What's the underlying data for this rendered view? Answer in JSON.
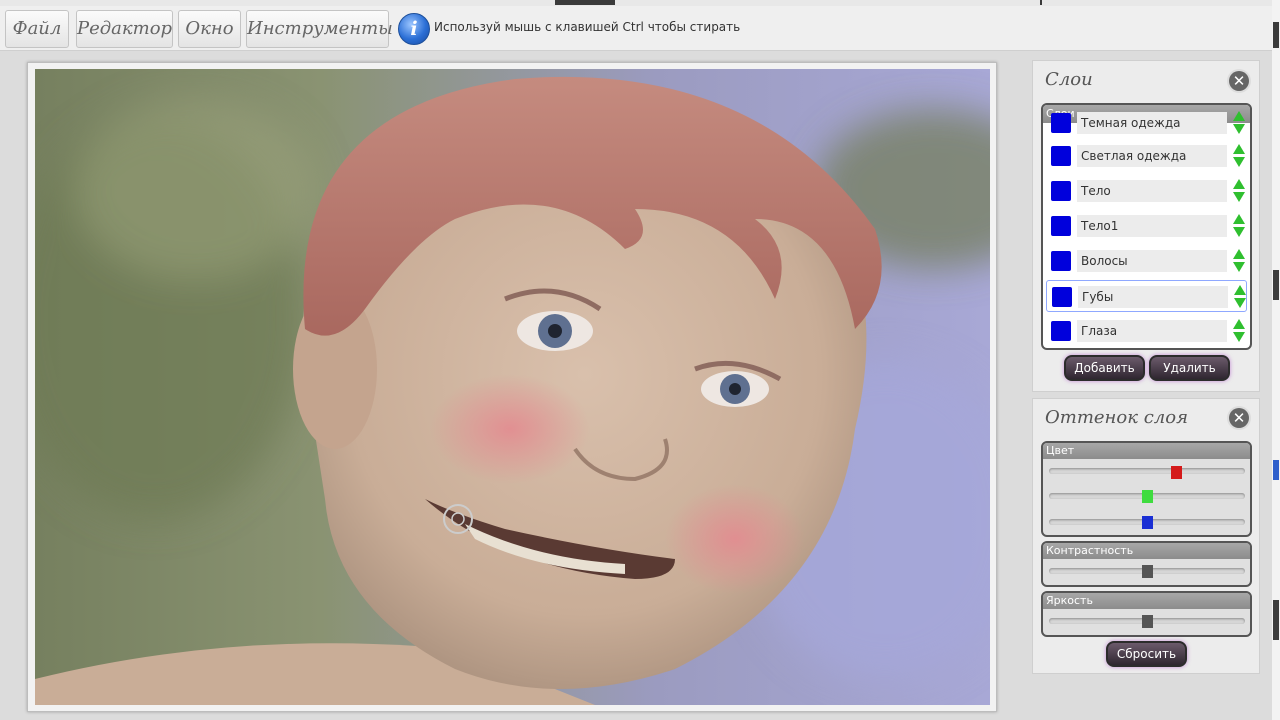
{
  "menu": {
    "file": "Файл",
    "editor": "Редактор",
    "window": "Окно",
    "tools": "Инструменты"
  },
  "hint": {
    "icon": "info-icon",
    "text": "Используй мышь с клавишей Ctrl чтобы стирать"
  },
  "layers_panel": {
    "title": "Слои",
    "box_header": "Слои",
    "items": [
      {
        "label": "Темная одежда"
      },
      {
        "label": "Светлая одежда"
      },
      {
        "label": "Тело"
      },
      {
        "label": "Тело1"
      },
      {
        "label": "Волосы"
      },
      {
        "label": "Губы",
        "selected": true
      },
      {
        "label": "Глаза"
      }
    ],
    "add_label": "Добавить",
    "delete_label": "Удалить",
    "swatch_color": "#0000dc",
    "arrow_color": "#2fbf2f"
  },
  "tint_panel": {
    "title": "Оттенок слоя",
    "color_label": "Цвет",
    "contrast_label": "Контрастность",
    "brightness_label": "Яркость",
    "reset_label": "Сбросить",
    "sliders": {
      "red": {
        "value": 0.65,
        "color": "#d41a1a"
      },
      "green": {
        "value": 0.5,
        "color": "#3fdc3f"
      },
      "blue": {
        "value": 0.5,
        "color": "#1a2fd4"
      },
      "contrast": {
        "value": 0.5,
        "color": "#555555"
      },
      "brightness": {
        "value": 0.5,
        "color": "#555555"
      }
    }
  }
}
